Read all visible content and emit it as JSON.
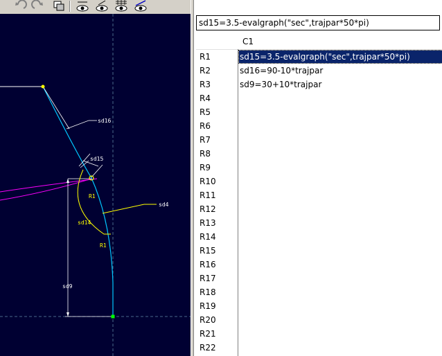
{
  "toolbar": {
    "buttons": [
      "undo-icon",
      "redo-icon",
      "copy-view-icon",
      "eye-icon",
      "eye-dimension-icon",
      "eye-grid-icon",
      "eye-sketch-icon"
    ]
  },
  "sketch": {
    "dimensions": {
      "sd16": "sd16",
      "sd15": "sd15",
      "sd4": "sd4",
      "sd14": "sd14",
      "sd9": "sd9",
      "r1_top": "R1",
      "r1_bottom": "R1"
    },
    "colors": {
      "background": "#000032",
      "curve": "#00c8ff",
      "dimension": "#ffffff",
      "arc": "#ffff00",
      "trajectory": "#ff00ff",
      "point": "#ffff00"
    }
  },
  "relations": {
    "formula_bar": "sd15=3.5-evalgraph(\"sec\",trajpar*50*pi)",
    "column_header": "C1",
    "rows": [
      {
        "label": "R1",
        "value": "sd15=3.5-evalgraph(\"sec\",trajpar*50*pi)"
      },
      {
        "label": "R2",
        "value": "sd16=90-10*trajpar"
      },
      {
        "label": "R3",
        "value": "sd9=30+10*trajpar"
      },
      {
        "label": "R4",
        "value": ""
      },
      {
        "label": "R5",
        "value": ""
      },
      {
        "label": "R6",
        "value": ""
      },
      {
        "label": "R7",
        "value": ""
      },
      {
        "label": "R8",
        "value": ""
      },
      {
        "label": "R9",
        "value": ""
      },
      {
        "label": "R10",
        "value": ""
      },
      {
        "label": "R11",
        "value": ""
      },
      {
        "label": "R12",
        "value": ""
      },
      {
        "label": "R13",
        "value": ""
      },
      {
        "label": "R14",
        "value": ""
      },
      {
        "label": "R15",
        "value": ""
      },
      {
        "label": "R16",
        "value": ""
      },
      {
        "label": "R17",
        "value": ""
      },
      {
        "label": "R18",
        "value": ""
      },
      {
        "label": "R19",
        "value": ""
      },
      {
        "label": "R20",
        "value": ""
      },
      {
        "label": "R21",
        "value": ""
      },
      {
        "label": "R22",
        "value": ""
      }
    ]
  }
}
